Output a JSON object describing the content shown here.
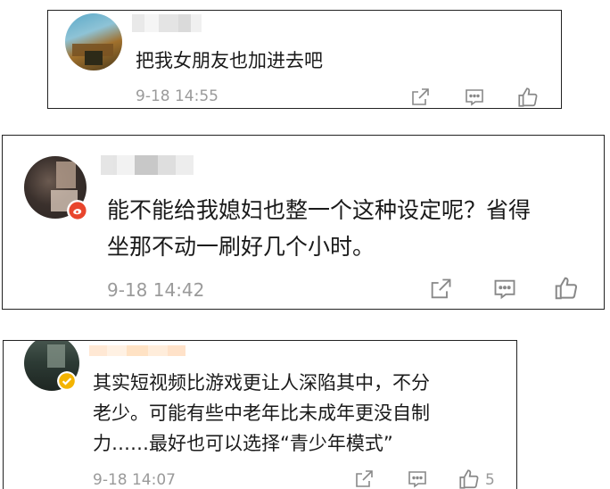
{
  "comments": [
    {
      "text": "把我女朋友也加进去吧",
      "time": "9-18 14:55",
      "likes": ""
    },
    {
      "text": "能不能给我媳妇也整一个这种设定呢？省得\n坐那不动一刷好几个小时。",
      "time": "9-18 14:42",
      "likes": ""
    },
    {
      "text": "其实短视频比游戏更让人深陷其中，不分\n老少。可能有些中老年比未成年更没自制\n力……最好也可以选择“青少年模式”",
      "time": "9-18 14:07",
      "likes": "5"
    }
  ],
  "icons": {
    "share": "share-icon",
    "comment": "comment-icon",
    "like": "thumbs-up-icon",
    "badge_red": "weibo-badge-icon",
    "badge_gold": "verified-badge-icon"
  },
  "colors": {
    "timestamp": "#9a9a9a",
    "text": "#1a1a1a",
    "badge_red": "#e8452c",
    "badge_gold": "#f4b400"
  }
}
